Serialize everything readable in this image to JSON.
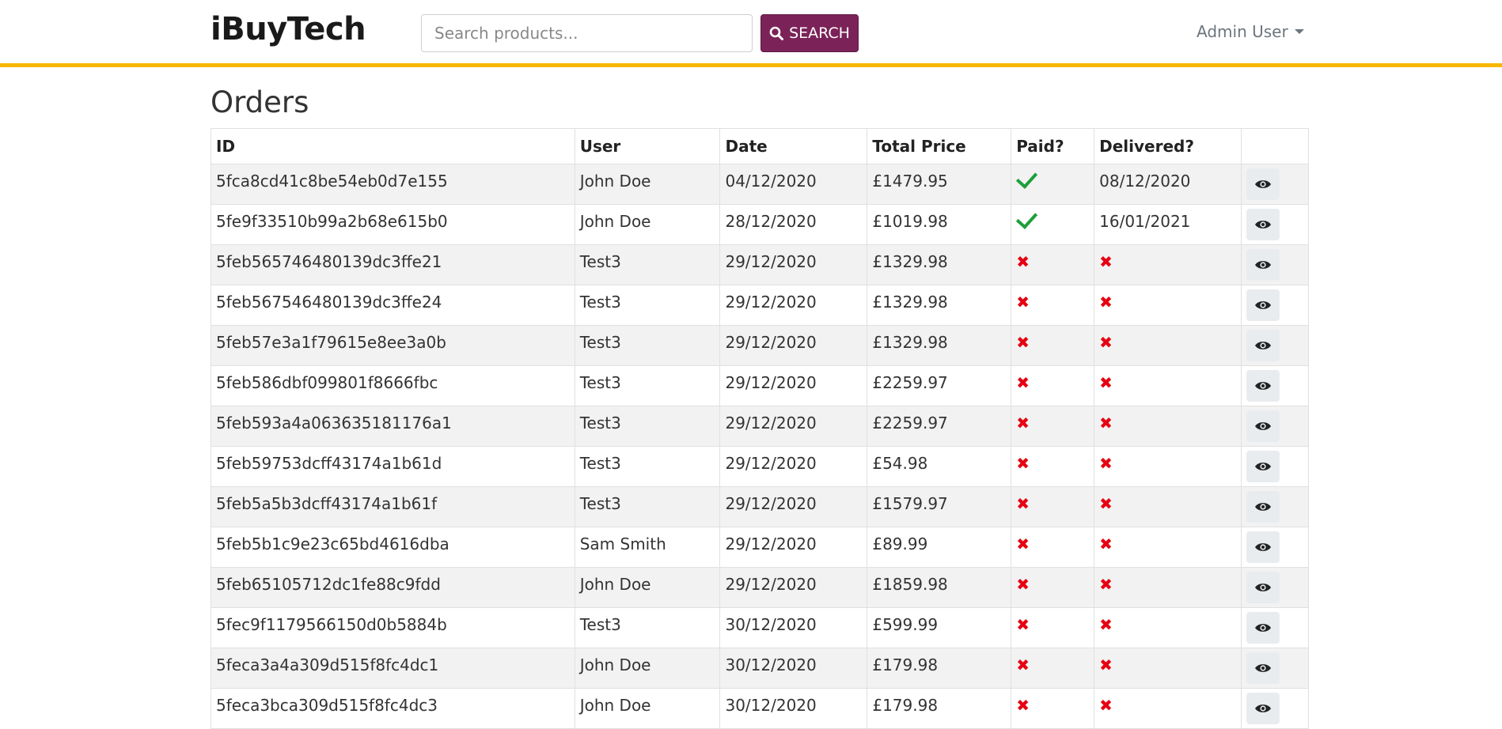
{
  "header": {
    "brand": "iBuyTech",
    "search_placeholder": "Search products...",
    "search_button": "SEARCH",
    "user_menu": "Admin User",
    "accent_color": "#f8b700",
    "button_color": "#7b2358"
  },
  "page": {
    "title": "Orders"
  },
  "table": {
    "columns": [
      "ID",
      "User",
      "Date",
      "Total Price",
      "Paid?",
      "Delivered?",
      ""
    ],
    "rows": [
      {
        "id": "5fca8cd41c8be54eb0d7e155",
        "user": "John Doe",
        "date": "04/12/2020",
        "total": "£1479.95",
        "paid": true,
        "delivered": "08/12/2020"
      },
      {
        "id": "5fe9f33510b99a2b68e615b0",
        "user": "John Doe",
        "date": "28/12/2020",
        "total": "£1019.98",
        "paid": true,
        "delivered": "16/01/2021"
      },
      {
        "id": "5feb565746480139dc3ffe21",
        "user": "Test3",
        "date": "29/12/2020",
        "total": "£1329.98",
        "paid": false,
        "delivered": null
      },
      {
        "id": "5feb567546480139dc3ffe24",
        "user": "Test3",
        "date": "29/12/2020",
        "total": "£1329.98",
        "paid": false,
        "delivered": null
      },
      {
        "id": "5feb57e3a1f79615e8ee3a0b",
        "user": "Test3",
        "date": "29/12/2020",
        "total": "£1329.98",
        "paid": false,
        "delivered": null
      },
      {
        "id": "5feb586dbf099801f8666fbc",
        "user": "Test3",
        "date": "29/12/2020",
        "total": "£2259.97",
        "paid": false,
        "delivered": null
      },
      {
        "id": "5feb593a4a063635181176a1",
        "user": "Test3",
        "date": "29/12/2020",
        "total": "£2259.97",
        "paid": false,
        "delivered": null
      },
      {
        "id": "5feb59753dcff43174a1b61d",
        "user": "Test3",
        "date": "29/12/2020",
        "total": "£54.98",
        "paid": false,
        "delivered": null
      },
      {
        "id": "5feb5a5b3dcff43174a1b61f",
        "user": "Test3",
        "date": "29/12/2020",
        "total": "£1579.97",
        "paid": false,
        "delivered": null
      },
      {
        "id": "5feb5b1c9e23c65bd4616dba",
        "user": "Sam Smith",
        "date": "29/12/2020",
        "total": "£89.99",
        "paid": false,
        "delivered": null
      },
      {
        "id": "5feb65105712dc1fe88c9fdd",
        "user": "John Doe",
        "date": "29/12/2020",
        "total": "£1859.98",
        "paid": false,
        "delivered": null
      },
      {
        "id": "5fec9f1179566150d0b5884b",
        "user": "Test3",
        "date": "30/12/2020",
        "total": "£599.99",
        "paid": false,
        "delivered": null
      },
      {
        "id": "5feca3a4a309d515f8fc4dc1",
        "user": "John Doe",
        "date": "30/12/2020",
        "total": "£179.98",
        "paid": false,
        "delivered": null
      },
      {
        "id": "5feca3bca309d515f8fc4dc3",
        "user": "John Doe",
        "date": "30/12/2020",
        "total": "£179.98",
        "paid": false,
        "delivered": null
      }
    ],
    "paid_icon": "check-icon",
    "unpaid_icon": "cross-icon",
    "action_icon": "eye-icon",
    "cross_glyph": "✖"
  }
}
